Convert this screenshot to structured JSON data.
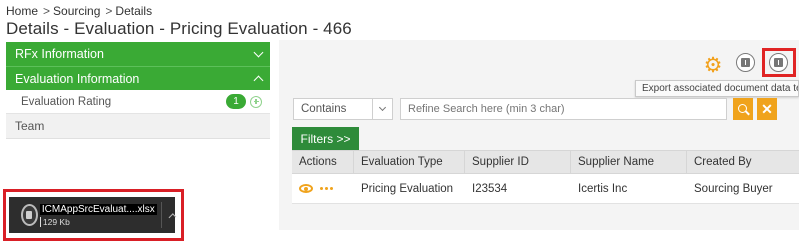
{
  "breadcrumb": {
    "items": [
      "Home",
      "Sourcing",
      "Details"
    ],
    "separator": ">"
  },
  "page_title": "Details - Evaluation - Pricing Evaluation - 466",
  "sidebar": {
    "sections": [
      {
        "label": "RFx Information",
        "state": "collapsed"
      },
      {
        "label": "Evaluation Information",
        "state": "expanded"
      }
    ],
    "sub_item": {
      "label": "Evaluation Rating",
      "count": "1"
    },
    "team_label": "Team"
  },
  "toolbar": {
    "icons": [
      "gear-icon",
      "export-document-icon",
      "export-associated-document-icon"
    ],
    "tooltip": "Export associated document data templa"
  },
  "search": {
    "operator": "Contains",
    "placeholder": "Refine Search here (min 3 char)",
    "clear_label": "✕"
  },
  "filters_label": "Filters >>",
  "grid": {
    "columns": [
      "Actions",
      "Evaluation Type",
      "Supplier ID",
      "Supplier Name",
      "Created By"
    ],
    "rows": [
      {
        "evaluation_type": "Pricing Evaluation",
        "supplier_id": "I23534",
        "supplier_name": "Icertis Inc",
        "created_by": "Sourcing Buyer"
      }
    ]
  },
  "download": {
    "file_name": "ICMAppSrcEvaluat....xlsx",
    "file_size": "129 Kb"
  },
  "colors": {
    "accent_green": "#3aaa35",
    "filters_green": "#2e8b3a",
    "action_orange": "#f0a31c",
    "highlight_red": "#e02424"
  }
}
